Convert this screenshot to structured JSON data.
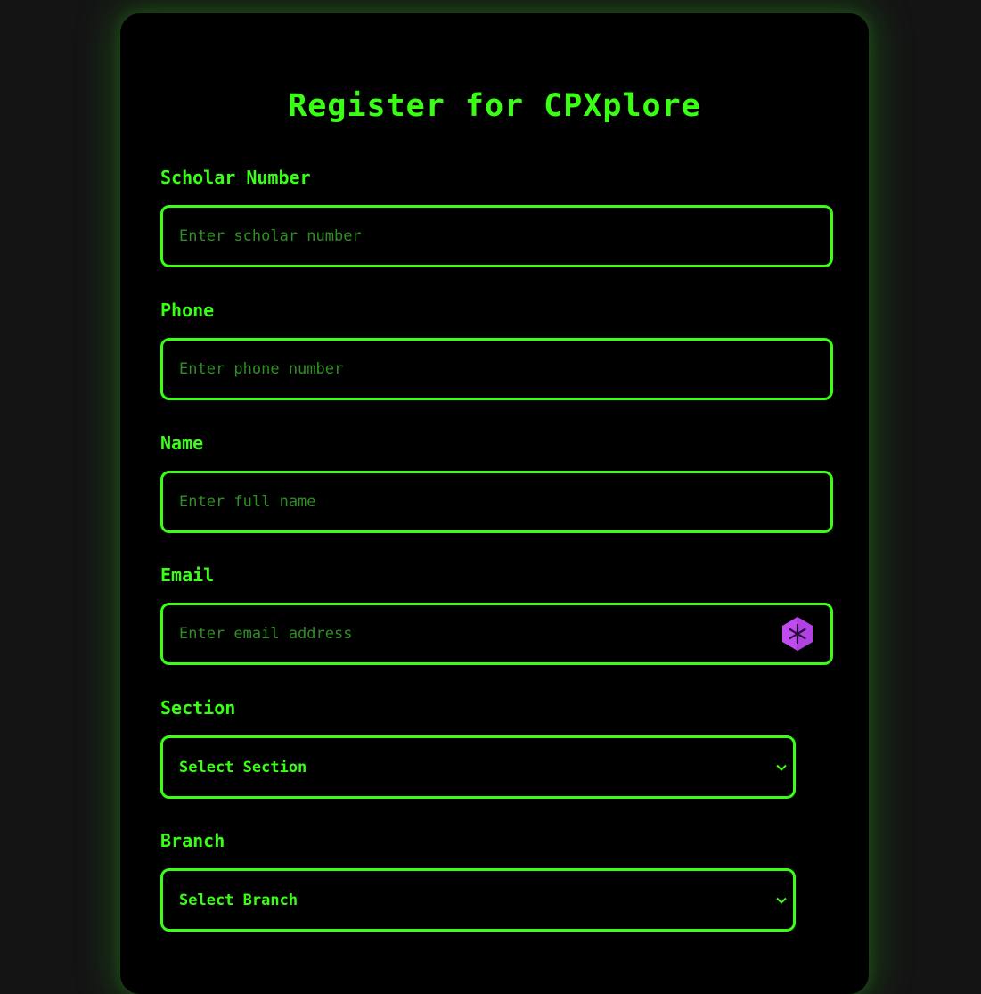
{
  "form": {
    "title": "Register for CPXplore",
    "scholar": {
      "label": "Scholar Number",
      "placeholder": "Enter scholar number"
    },
    "phone": {
      "label": "Phone",
      "placeholder": "Enter phone number"
    },
    "name": {
      "label": "Name",
      "placeholder": "Enter full name"
    },
    "email": {
      "label": "Email",
      "placeholder": "Enter email address",
      "extension_icon": "password-manager-extension-icon"
    },
    "section": {
      "label": "Section",
      "selected": "Select Section"
    },
    "branch": {
      "label": "Branch",
      "selected": "Select Branch"
    }
  },
  "colors": {
    "accent": "#39ff14",
    "placeholder": "#2f8f22",
    "card_bg": "#000000",
    "page_bg": "#141414",
    "extension_icon": "#c04cf0"
  }
}
